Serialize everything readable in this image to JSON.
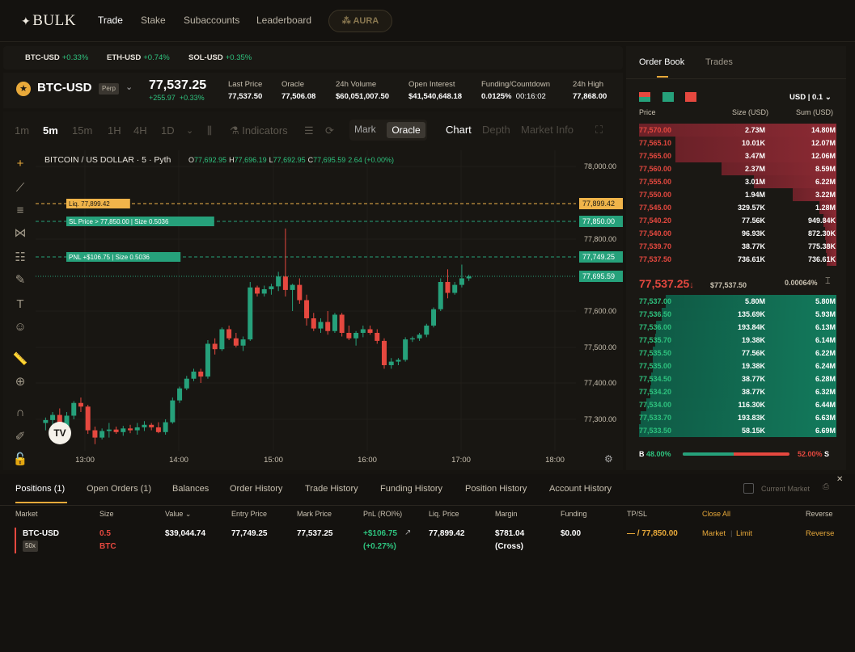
{
  "nav": {
    "logo": "BULK",
    "items": [
      "Trade",
      "Stake",
      "Subaccounts",
      "Leaderboard"
    ],
    "aura": "AURA"
  },
  "tickers": [
    {
      "sym": "BTC-USD",
      "chg": "+0.33%"
    },
    {
      "sym": "ETH-USD",
      "chg": "+0.74%"
    },
    {
      "sym": "SOL-USD",
      "chg": "+0.35%"
    }
  ],
  "market": {
    "name": "BTC-USD",
    "badge": "Perp",
    "price": "77,537.25",
    "change_abs": "+255.97",
    "change_pct": "+0.33%",
    "stats": [
      {
        "label": "Last Price",
        "value": "77,537.50"
      },
      {
        "label": "Oracle",
        "value": "77,506.08"
      },
      {
        "label": "24h Volume",
        "value": "$60,051,007.50"
      },
      {
        "label": "Open Interest",
        "value": "$41,540,648.18"
      },
      {
        "label": "Funding/Countdown",
        "value": "0.0125%",
        "value2": "00:16:02"
      },
      {
        "label": "24h High",
        "value": "77,868.00"
      }
    ]
  },
  "timeframes": [
    "1m",
    "5m",
    "15m",
    "1H",
    "4H",
    "1D"
  ],
  "chart_toolbar": {
    "indicators": "Indicators",
    "mark": "Mark",
    "oracle": "Oracle",
    "views": [
      "Chart",
      "Depth",
      "Market Info"
    ]
  },
  "chart_legend": {
    "title": "BITCOIN / US DOLLAR · 5 · Pyth",
    "o": "77,692.95",
    "h": "77,696.19",
    "l": "77,692.95",
    "c": "77,695.59",
    "chg": "2.64 (+0.00%)"
  },
  "chart_data": {
    "type": "candlestick",
    "x_ticks": [
      "13:00",
      "14:00",
      "15:00",
      "16:00",
      "17:00",
      "18:00"
    ],
    "y_ticks": [
      "78,000.00",
      "77,800.00",
      "77,600.00",
      "77,500.00",
      "77,400.00",
      "77,300.00"
    ],
    "y_range": [
      77227,
      78050
    ],
    "price_lines": [
      {
        "label": "Liq. 77,899.42",
        "value": 77899.42,
        "axis": "77,899.42",
        "color": "#f0b44a"
      },
      {
        "label": "SL Price > 77,850.00 | Size 0.5036",
        "value": 77850,
        "axis": "77,850.00",
        "color": "#26a17b"
      },
      {
        "label": "PNL +$106.75 | Size 0.5036",
        "value": 77749.25,
        "axis": "77,749.25",
        "color": "#26a17b"
      },
      {
        "label": "",
        "value": 77695.59,
        "axis": "77,695.59",
        "color": "#26a17b"
      }
    ],
    "candles": [
      [
        77290,
        77305,
        77270,
        77298
      ],
      [
        77298,
        77320,
        77285,
        77312
      ],
      [
        77312,
        77330,
        77240,
        77262
      ],
      [
        77262,
        77320,
        77255,
        77310
      ],
      [
        77310,
        77350,
        77300,
        77345
      ],
      [
        77345,
        77360,
        77320,
        77335
      ],
      [
        77335,
        77340,
        77260,
        77270
      ],
      [
        77270,
        77280,
        77232,
        77250
      ],
      [
        77250,
        77275,
        77245,
        77268
      ],
      [
        77268,
        77290,
        77250,
        77272
      ],
      [
        77272,
        77280,
        77260,
        77265
      ],
      [
        77265,
        77282,
        77255,
        77275
      ],
      [
        77275,
        77285,
        77262,
        77270
      ],
      [
        77270,
        77290,
        77258,
        77278
      ],
      [
        77278,
        77295,
        77268,
        77285
      ],
      [
        77285,
        77290,
        77270,
        77278
      ],
      [
        77278,
        77292,
        77262,
        77265
      ],
      [
        77265,
        77300,
        77258,
        77292
      ],
      [
        77292,
        77360,
        77288,
        77352
      ],
      [
        77352,
        77390,
        77345,
        77385
      ],
      [
        77385,
        77420,
        77380,
        77412
      ],
      [
        77412,
        77440,
        77405,
        77432
      ],
      [
        77432,
        77440,
        77400,
        77418
      ],
      [
        77418,
        77520,
        77412,
        77510
      ],
      [
        77510,
        77525,
        77480,
        77495
      ],
      [
        77495,
        77555,
        77490,
        77550
      ],
      [
        77550,
        77560,
        77520,
        77525
      ],
      [
        77525,
        77540,
        77500,
        77505
      ],
      [
        77505,
        77530,
        77490,
        77522
      ],
      [
        77522,
        77680,
        77518,
        77665
      ],
      [
        77665,
        77670,
        77640,
        77648
      ],
      [
        77648,
        77670,
        77640,
        77660
      ],
      [
        77660,
        77675,
        77645,
        77668
      ],
      [
        77668,
        77708,
        77655,
        77695
      ],
      [
        77695,
        77830,
        77640,
        77658
      ],
      [
        77658,
        77675,
        77600,
        77672
      ],
      [
        77672,
        77690,
        77620,
        77630
      ],
      [
        77630,
        77645,
        77560,
        77580
      ],
      [
        77580,
        77595,
        77545,
        77552
      ],
      [
        77552,
        77580,
        77540,
        77570
      ],
      [
        77570,
        77600,
        77535,
        77545
      ],
      [
        77545,
        77595,
        77540,
        77590
      ],
      [
        77590,
        77595,
        77530,
        77540
      ],
      [
        77540,
        77560,
        77520,
        77525
      ],
      [
        77525,
        77545,
        77505,
        77540
      ],
      [
        77540,
        77560,
        77528,
        77550
      ],
      [
        77550,
        77560,
        77535,
        77540
      ],
      [
        77540,
        77550,
        77510,
        77518
      ],
      [
        77518,
        77525,
        77440,
        77450
      ],
      [
        77450,
        77470,
        77440,
        77460
      ],
      [
        77460,
        77470,
        77450,
        77465
      ],
      [
        77465,
        77528,
        77460,
        77522
      ],
      [
        77522,
        77530,
        77515,
        77525
      ],
      [
        77525,
        77540,
        77518,
        77535
      ],
      [
        77535,
        77565,
        77528,
        77560
      ],
      [
        77560,
        77610,
        77555,
        77605
      ],
      [
        77605,
        77690,
        77600,
        77680
      ],
      [
        77680,
        77715,
        77635,
        77650
      ],
      [
        77650,
        77680,
        77645,
        77672
      ],
      [
        77672,
        77728,
        77665,
        77690
      ],
      [
        77690,
        77700,
        77683,
        77695
      ]
    ]
  },
  "orderbook": {
    "tabs": [
      "Order Book",
      "Trades"
    ],
    "unit": "USD | 0.1",
    "headers": [
      "Price",
      "Size (USD)",
      "Sum (USD)"
    ],
    "asks": [
      {
        "p": "77,570.00",
        "s": "2.73M",
        "c": "14.80M",
        "d": 1.0
      },
      {
        "p": "77,565.10",
        "s": "10.01K",
        "c": "12.07M",
        "d": 0.816
      },
      {
        "p": "77,565.00",
        "s": "3.47M",
        "c": "12.06M",
        "d": 0.815
      },
      {
        "p": "77,560.00",
        "s": "2.37M",
        "c": "8.59M",
        "d": 0.58
      },
      {
        "p": "77,555.00",
        "s": "3.01M",
        "c": "6.22M",
        "d": 0.42
      },
      {
        "p": "77,550.00",
        "s": "1.94M",
        "c": "3.22M",
        "d": 0.22
      },
      {
        "p": "77,545.00",
        "s": "329.57K",
        "c": "1.28M",
        "d": 0.087
      },
      {
        "p": "77,540.20",
        "s": "77.56K",
        "c": "949.84K",
        "d": 0.064
      },
      {
        "p": "77,540.00",
        "s": "96.93K",
        "c": "872.30K",
        "d": 0.059
      },
      {
        "p": "77,539.70",
        "s": "38.77K",
        "c": "775.38K",
        "d": 0.052
      },
      {
        "p": "77,537.50",
        "s": "736.61K",
        "c": "736.61K",
        "d": 0.05
      }
    ],
    "mid": {
      "price": "77,537.25",
      "arrow": "↓",
      "oracle": "$77,537.50",
      "spread": "0.00064%"
    },
    "bids": [
      {
        "p": "77,537.00",
        "s": "5.80M",
        "c": "5.80M",
        "d": 0.866
      },
      {
        "p": "77,536.50",
        "s": "135.69K",
        "c": "5.93M",
        "d": 0.886
      },
      {
        "p": "77,536.00",
        "s": "193.84K",
        "c": "6.13M",
        "d": 0.916
      },
      {
        "p": "77,535.70",
        "s": "19.38K",
        "c": "6.14M",
        "d": 0.918
      },
      {
        "p": "77,535.50",
        "s": "77.56K",
        "c": "6.22M",
        "d": 0.93
      },
      {
        "p": "77,535.00",
        "s": "19.38K",
        "c": "6.24M",
        "d": 0.932
      },
      {
        "p": "77,534.50",
        "s": "38.77K",
        "c": "6.28M",
        "d": 0.938
      },
      {
        "p": "77,534.20",
        "s": "38.77K",
        "c": "6.32M",
        "d": 0.944
      },
      {
        "p": "77,534.00",
        "s": "116.30K",
        "c": "6.44M",
        "d": 0.962
      },
      {
        "p": "77,533.70",
        "s": "193.83K",
        "c": "6.63M",
        "d": 0.99
      },
      {
        "p": "77,533.50",
        "s": "58.15K",
        "c": "6.69M",
        "d": 1.0
      }
    ],
    "ratio": {
      "b_label": "B",
      "b": "48.00%",
      "s_label": "S",
      "s": "52.00%",
      "b_frac": 0.48
    }
  },
  "bottom": {
    "tabs": [
      "Positions (1)",
      "Open Orders (1)",
      "Balances",
      "Order History",
      "Trade History",
      "Funding History",
      "Position History",
      "Account History"
    ],
    "current_market": "Current Market",
    "headers": [
      "Market",
      "Size",
      "Value",
      "Entry Price",
      "Mark Price",
      "PnL (ROI%)",
      "Liq. Price",
      "Margin",
      "Funding",
      "TP/SL",
      "Close All",
      "Reverse"
    ],
    "position": {
      "market": "BTC-USD",
      "lev": "50x",
      "size": "0.5",
      "size_unit": "BTC",
      "value": "$39,044.74",
      "entry": "77,749.25",
      "mark": "77,537.25",
      "pnl": "+$106.75",
      "roi": "(+0.27%)",
      "liq": "77,899.42",
      "margin": "$781.04",
      "margin_mode": "(Cross)",
      "funding": "$0.00",
      "tpsl": "— / 77,850.00",
      "market_btn": "Market",
      "limit_btn": "Limit",
      "reverse_btn": "Reverse"
    }
  },
  "colors": {
    "up": "#26a17b",
    "down": "#e5483f",
    "accent": "#e8a93a"
  }
}
